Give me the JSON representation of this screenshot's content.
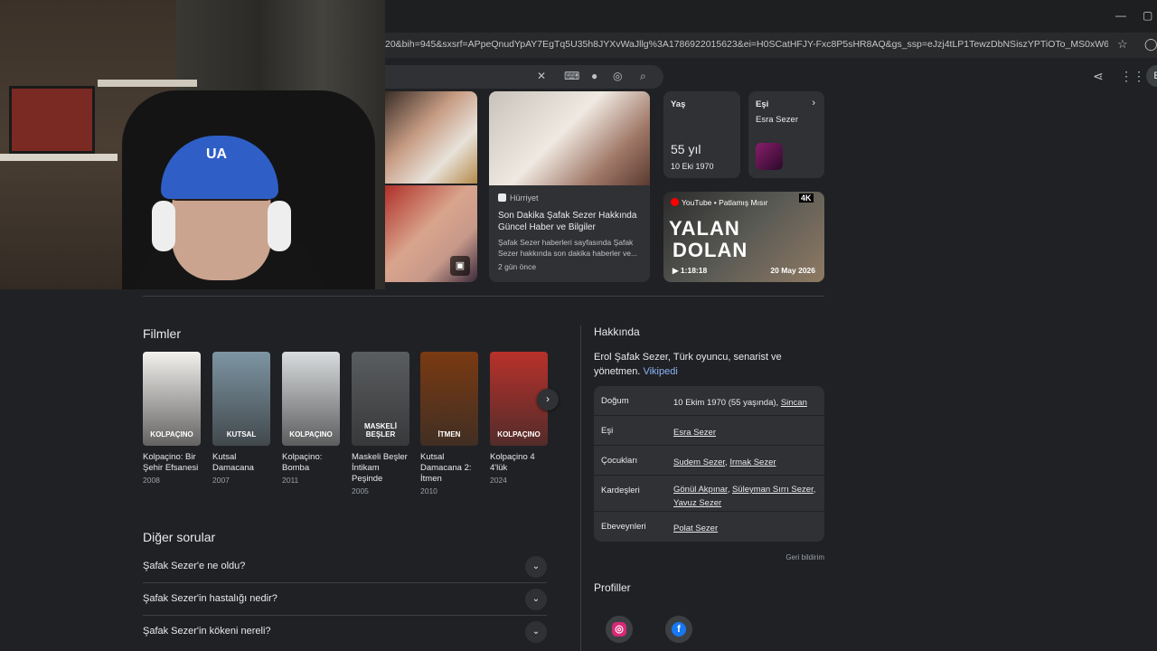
{
  "browser": {
    "url": "20&bih=945&sxsrf=APpeQnudYpAY7EgTq5U35h8JYXvWaJllg%3A1786922015623&ei=H0SCatHFJY-Fxc8P5sHR8AQ&gs_ssp=eJzj4tLP1TewzDbNSiszYPTiOTo_MS0xW6E4tSq1CABvcAj2&oq=...",
    "profile_initial": "E"
  },
  "webcam": {
    "cap_logo": "UA"
  },
  "news": {
    "source": "Hürriyet",
    "title": "Son Dakika Şafak Sezer Hakkında Güncel Haber ve Bilgiler",
    "snippet": "Şafak Sezer haberleri sayfasında Şafak Sezer hakkında son dakika haberler ve...",
    "age": "2 gün önce"
  },
  "age_card": {
    "label": "Yaş",
    "value": "55 yıl",
    "date": "10 Eki 1970"
  },
  "spouse_card": {
    "label": "Eşi",
    "value": "Esra Sezer"
  },
  "video": {
    "source": "YouTube • Patlamış Mısır",
    "quality": "4K",
    "title_line1": "YALAN",
    "title_line2": "DOLAN",
    "duration": "1:18:18",
    "date": "20 May 2026"
  },
  "films_section": {
    "title": "Filmler",
    "items": [
      {
        "title": "Kolpaçino: Bir Şehir Efsanesi",
        "year": "2008",
        "poster_text": "KOLPAÇINO",
        "color": "#f3f1ee"
      },
      {
        "title": "Kutsal Damacana",
        "year": "2007",
        "poster_text": "KUTSAL",
        "color": "#7d95a3"
      },
      {
        "title": "Kolpaçino: Bomba",
        "year": "2011",
        "poster_text": "KOLPAÇINO",
        "color": "#d9dcde"
      },
      {
        "title": "Maskeli Beşler İntikam Peşinde",
        "year": "2005",
        "poster_text": "MASKELİ BEŞLER",
        "color": "#5a5d60"
      },
      {
        "title": "Kutsal Damacana 2: İtmen",
        "year": "2010",
        "poster_text": "İTMEN",
        "color": "#7a3a12"
      },
      {
        "title": "Kolpaçino 4 4'lük",
        "year": "2024",
        "poster_text": "KOLPAÇINO",
        "color": "#b8312b"
      }
    ]
  },
  "questions": {
    "title": "Diğer sorular",
    "items": [
      "Şafak Sezer'e ne oldu?",
      "Şafak Sezer'in hastalığı nedir?",
      "Şafak Sezer'in kökeni nereli?"
    ]
  },
  "about": {
    "title": "Hakkında",
    "description": "Erol Şafak Sezer, Türk oyuncu, senarist ve yönetmen.",
    "source_link": "Vikipedi",
    "facts": {
      "birth": {
        "label": "Doğum",
        "value": "10 Ekim 1970 (55 yaşında), ",
        "place": "Sincan"
      },
      "spouse": {
        "label": "Eşi",
        "value": "Esra Sezer"
      },
      "children": {
        "label": "Çocukları",
        "v1": "Sudem Sezer",
        "v2": "Irmak Sezer"
      },
      "siblings": {
        "label": "Kardeşleri",
        "v1": "Gönül Akpınar",
        "v2": "Süleyman Sırrı Sezer",
        "v3": "Yavuz Sezer"
      },
      "parents": {
        "label": "Ebeveynleri",
        "value": "Polat Sezer"
      }
    },
    "feedback": "Geri bildirim"
  },
  "profiles": {
    "title": "Profiller",
    "instagram_color": "#d62976",
    "facebook_color": "#1877f2"
  }
}
